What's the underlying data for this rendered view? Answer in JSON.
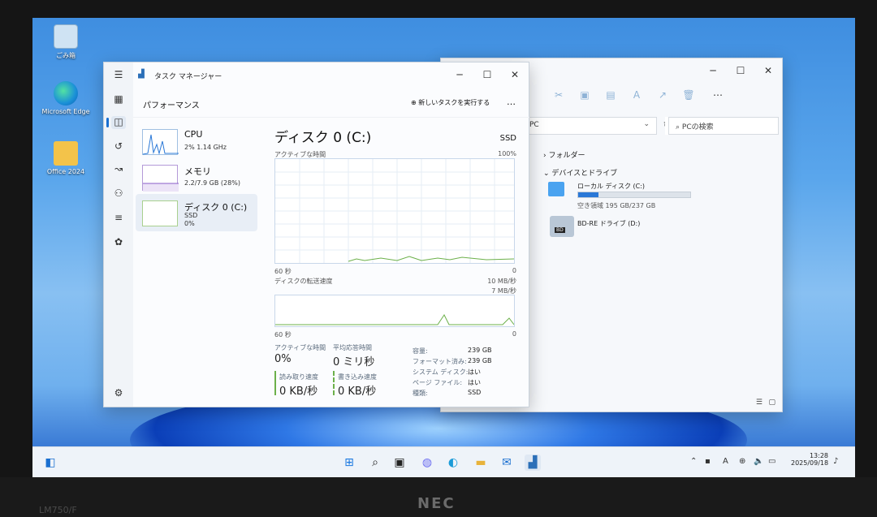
{
  "desktop": {
    "icons": [
      {
        "label": "ごみ箱"
      },
      {
        "label": "Microsoft Edge"
      },
      {
        "label": "Office 2024"
      }
    ]
  },
  "explorer": {
    "address": "PC",
    "search_placeholder": "PCの検索",
    "folders_label": "フォルダー",
    "devices_label": "デバイスとドライブ",
    "local_disk": {
      "name": "ローカル ディスク (C:)",
      "free": "空き領域 195 GB/237 GB",
      "used_fraction": 0.18
    },
    "bd_drive": {
      "name": "BD-RE ドライブ (D:)",
      "badge": "BD"
    }
  },
  "taskmanager": {
    "title": "タスク マネージャー",
    "section": "パフォーマンス",
    "new_task_label": "新しいタスクを実行する",
    "more_label": "…",
    "items": [
      {
        "name": "CPU",
        "sub1": "2% 1.14 GHz",
        "sub2": ""
      },
      {
        "name": "メモリ",
        "sub1": "2.2/7.9 GB (28%)",
        "sub2": ""
      },
      {
        "name": "ディスク 0 (C:)",
        "sub1": "SSD",
        "sub2": "0%"
      }
    ],
    "detail": {
      "title": "ディスク 0 (C:)",
      "type": "SSD",
      "graph1_label": "アクティブな時間",
      "graph1_max": "100%",
      "graph1_xlabel": "60 秒",
      "graph1_xmin": "0",
      "graph2_label": "ディスクの転送速度",
      "graph2_max": "10 MB/秒",
      "graph2_mid": "7 MB/秒",
      "graph2_xlabel": "60 秒",
      "graph2_xmin": "0",
      "active_time_label": "アクティブな時間",
      "active_time": "0%",
      "avg_response_label": "平均応答時間",
      "avg_response": "0 ミリ秒",
      "read_label": "読み取り速度",
      "read": "0 KB/秒",
      "write_label": "書き込み速度",
      "write": "0 KB/秒",
      "props": [
        {
          "k": "容量:",
          "v": "239 GB"
        },
        {
          "k": "フォーマット済み:",
          "v": "239 GB"
        },
        {
          "k": "システム ディスク:",
          "v": "はい"
        },
        {
          "k": "ページ ファイル:",
          "v": "はい"
        },
        {
          "k": "種類:",
          "v": "SSD"
        }
      ]
    }
  },
  "taskbar": {
    "time": "13:28",
    "date": "2025/09/18",
    "ime": "A"
  },
  "hardware": {
    "brand": "NEC",
    "model": "LM750/F"
  }
}
